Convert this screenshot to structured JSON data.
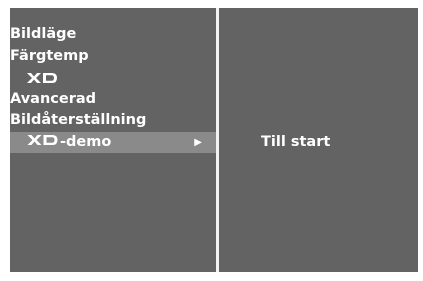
{
  "menu": {
    "items": [
      {
        "label": "Bildläge"
      },
      {
        "label": "Färgtemp"
      },
      {
        "label": "",
        "logo": "XD"
      },
      {
        "label": "Avancerad"
      },
      {
        "label": "Bildåterställning"
      },
      {
        "label": "-demo",
        "logo": "XD",
        "selected": true,
        "arrow": "▶"
      }
    ]
  },
  "submenu": {
    "label": "Till start"
  },
  "colors": {
    "panel": "#636363",
    "highlight": "#8a8a8a",
    "divider": "#f2f2f2",
    "text": "#ffffff"
  }
}
